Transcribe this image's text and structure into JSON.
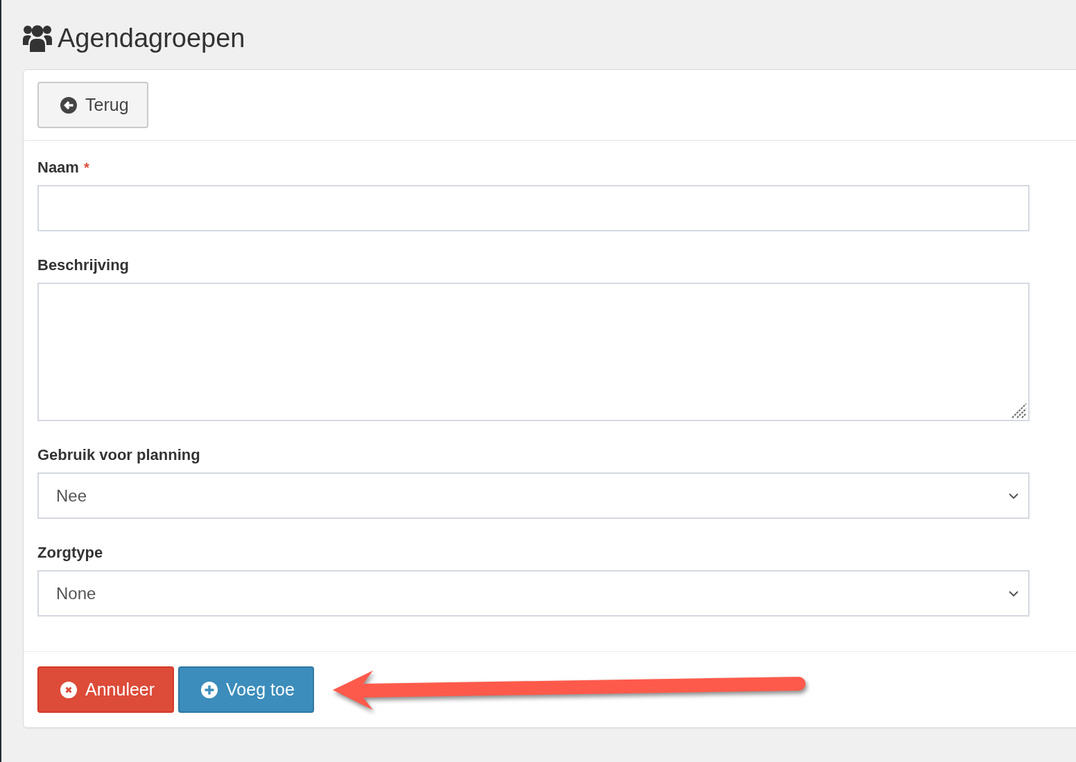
{
  "page_header": {
    "title": "Agendagroepen"
  },
  "card": {
    "toolbar": [
      {
        "kind": "back",
        "label": "Terug"
      }
    ],
    "fields": [
      {
        "kind": "text",
        "label": "Naam",
        "required_mark": "*"
      },
      {
        "kind": "textarea",
        "label": "Beschrijving"
      },
      {
        "kind": "select",
        "label": "Gebruik voor planning",
        "value": "Nee"
      },
      {
        "kind": "select",
        "label": "Zorgtype",
        "value": "None"
      }
    ],
    "actions": [
      {
        "kind": "cancel",
        "label": "Annuleer"
      },
      {
        "kind": "add",
        "label": "Voeg toe"
      }
    ]
  },
  "annotations": [
    {
      "kind": "arrow"
    }
  ]
}
